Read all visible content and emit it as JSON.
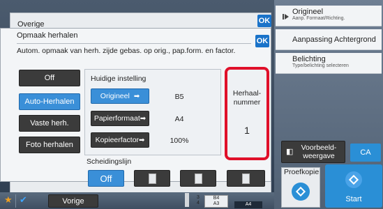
{
  "outer": {
    "title": "Overige",
    "ok_label": "OK"
  },
  "dialog": {
    "title": "Opmaak herhalen",
    "ok_label": "OK",
    "description": "Autom. opmaak van herh. zijde gebas. op orig., pap.form. en factor."
  },
  "modes": [
    {
      "label": "Off",
      "active": false
    },
    {
      "label": "Auto-Herhalen",
      "active": true
    },
    {
      "label": "Vaste herh.",
      "active": false
    },
    {
      "label": "Foto herhalen",
      "active": false
    }
  ],
  "current": {
    "heading": "Huidige instelling",
    "rows": [
      {
        "label": "Origineel",
        "value": "B5"
      },
      {
        "label": "Papierformaat",
        "value": "A4"
      },
      {
        "label": "Kopieerfactor",
        "value": "100%"
      }
    ]
  },
  "repeat": {
    "label_line1": "Herhaal-",
    "label_line2": "nummer",
    "value": "1"
  },
  "separator": {
    "heading": "Scheidingslijn",
    "off_label": "Off"
  },
  "right_panel": {
    "items": [
      {
        "title": "Origineel",
        "subtitle": "Aanp. Formaat/Richting."
      },
      {
        "title": "Aanpassing Achtergrond",
        "subtitle": ""
      },
      {
        "title": "Belichting",
        "subtitle": "Type/belichting selecteren"
      }
    ]
  },
  "actions": {
    "preview_line1": "Voorbeeld-",
    "preview_line2": "weergave",
    "ca_label": "CA",
    "proof_label": "Proefkopie",
    "start_label": "Start"
  },
  "bottom": {
    "back_label": "Vorige",
    "trays": [
      {
        "num": "3",
        "size": "B4"
      },
      {
        "num": "4",
        "size": "A3"
      },
      {
        "num": "",
        "size": "A4"
      }
    ]
  },
  "colors": {
    "accent": "#3a8fd8",
    "highlight": "#e0102a"
  }
}
